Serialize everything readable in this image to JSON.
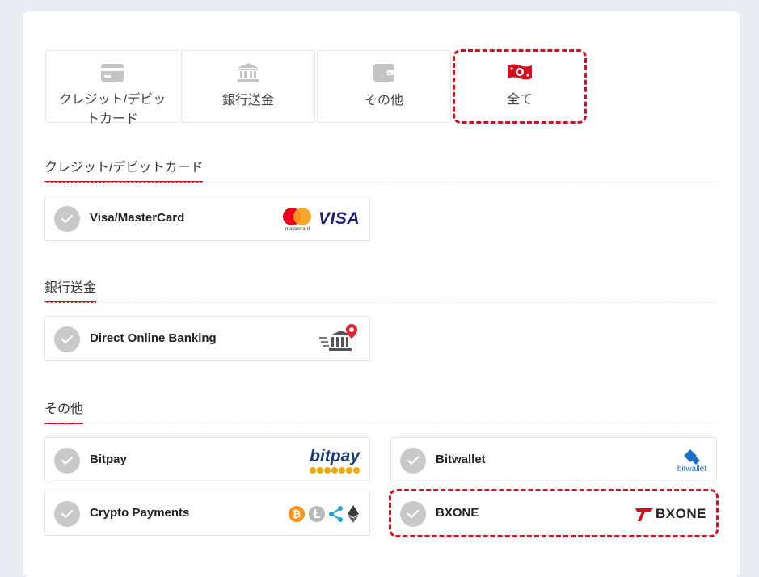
{
  "tabs": [
    {
      "label": "クレジット/デビットカード",
      "icon": "credit-card-icon"
    },
    {
      "label": "銀行送金",
      "icon": "bank-icon"
    },
    {
      "label": "その他",
      "icon": "wallet-icon"
    },
    {
      "label": "全て",
      "icon": "money-icon",
      "selected": true
    }
  ],
  "sections": {
    "card": {
      "title": "クレジット/デビットカード",
      "items": [
        {
          "label": "Visa/MasterCard",
          "logo_text": "VISA",
          "logo_sub": "mastercard"
        }
      ]
    },
    "bank": {
      "title": "銀行送金",
      "items": [
        {
          "label": "Direct Online Banking"
        }
      ]
    },
    "other": {
      "title": "その他",
      "items": [
        {
          "label": "Bitpay",
          "logo_text": "bitpay"
        },
        {
          "label": "Bitwallet",
          "logo_text": "bitwallet"
        },
        {
          "label": "Crypto Payments"
        },
        {
          "label": "BXONE",
          "logo_text": "BXONE",
          "highlighted": true
        }
      ]
    }
  },
  "colors": {
    "accent": "#d40f1f",
    "check_gray": "#c9c9c9",
    "background": "#e9edf4",
    "visa_blue": "#1a1f71",
    "bitpay_blue": "#1a3b73",
    "bitwallet_blue": "#1d6fc8"
  }
}
